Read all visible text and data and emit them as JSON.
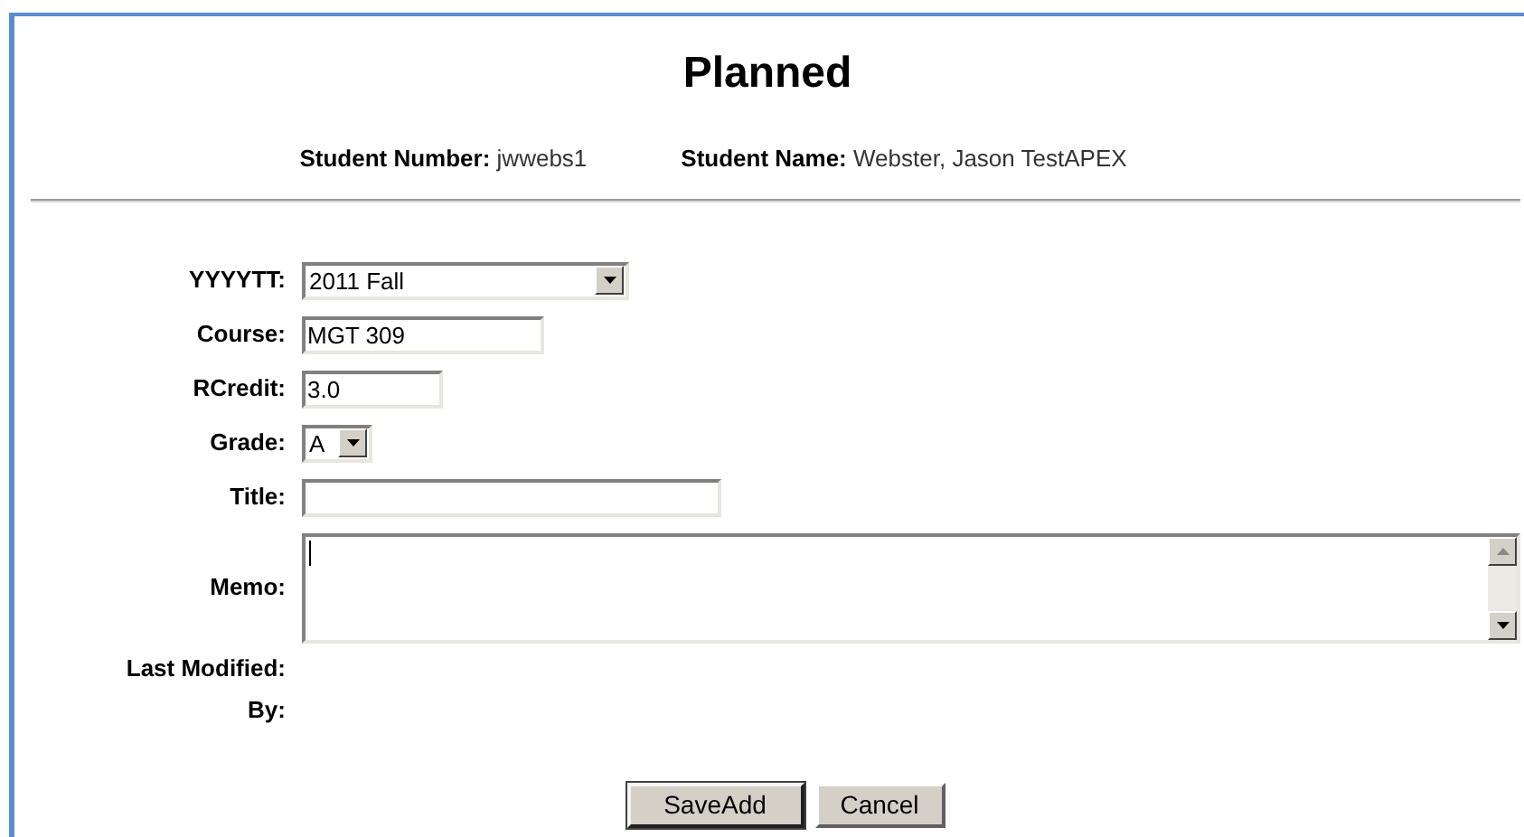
{
  "heading": "Planned",
  "student": [
    {
      "label": "Student Number:",
      "value": "jwwebs1"
    },
    {
      "label": "Student Name:",
      "value": "Webster, Jason TestAPEX"
    }
  ],
  "form": [
    {
      "label": "YYYYTT:",
      "kind": "select",
      "value": "2011 Fall"
    },
    {
      "label": "Course:",
      "kind": "text",
      "value": "MGT 309"
    },
    {
      "label": "RCredit:",
      "kind": "text",
      "value": "3.0"
    },
    {
      "label": "Grade:",
      "kind": "select",
      "value": "A"
    },
    {
      "label": "Title:",
      "kind": "text"
    },
    {
      "label": "Memo:",
      "kind": "textarea",
      "focused": true
    },
    {
      "label": "Last Modified:",
      "kind": "info"
    },
    {
      "label": "By:",
      "kind": "info"
    }
  ],
  "buttons": [
    {
      "label": "SaveAdd",
      "default": true
    },
    {
      "label": "Cancel",
      "default": false
    }
  ]
}
